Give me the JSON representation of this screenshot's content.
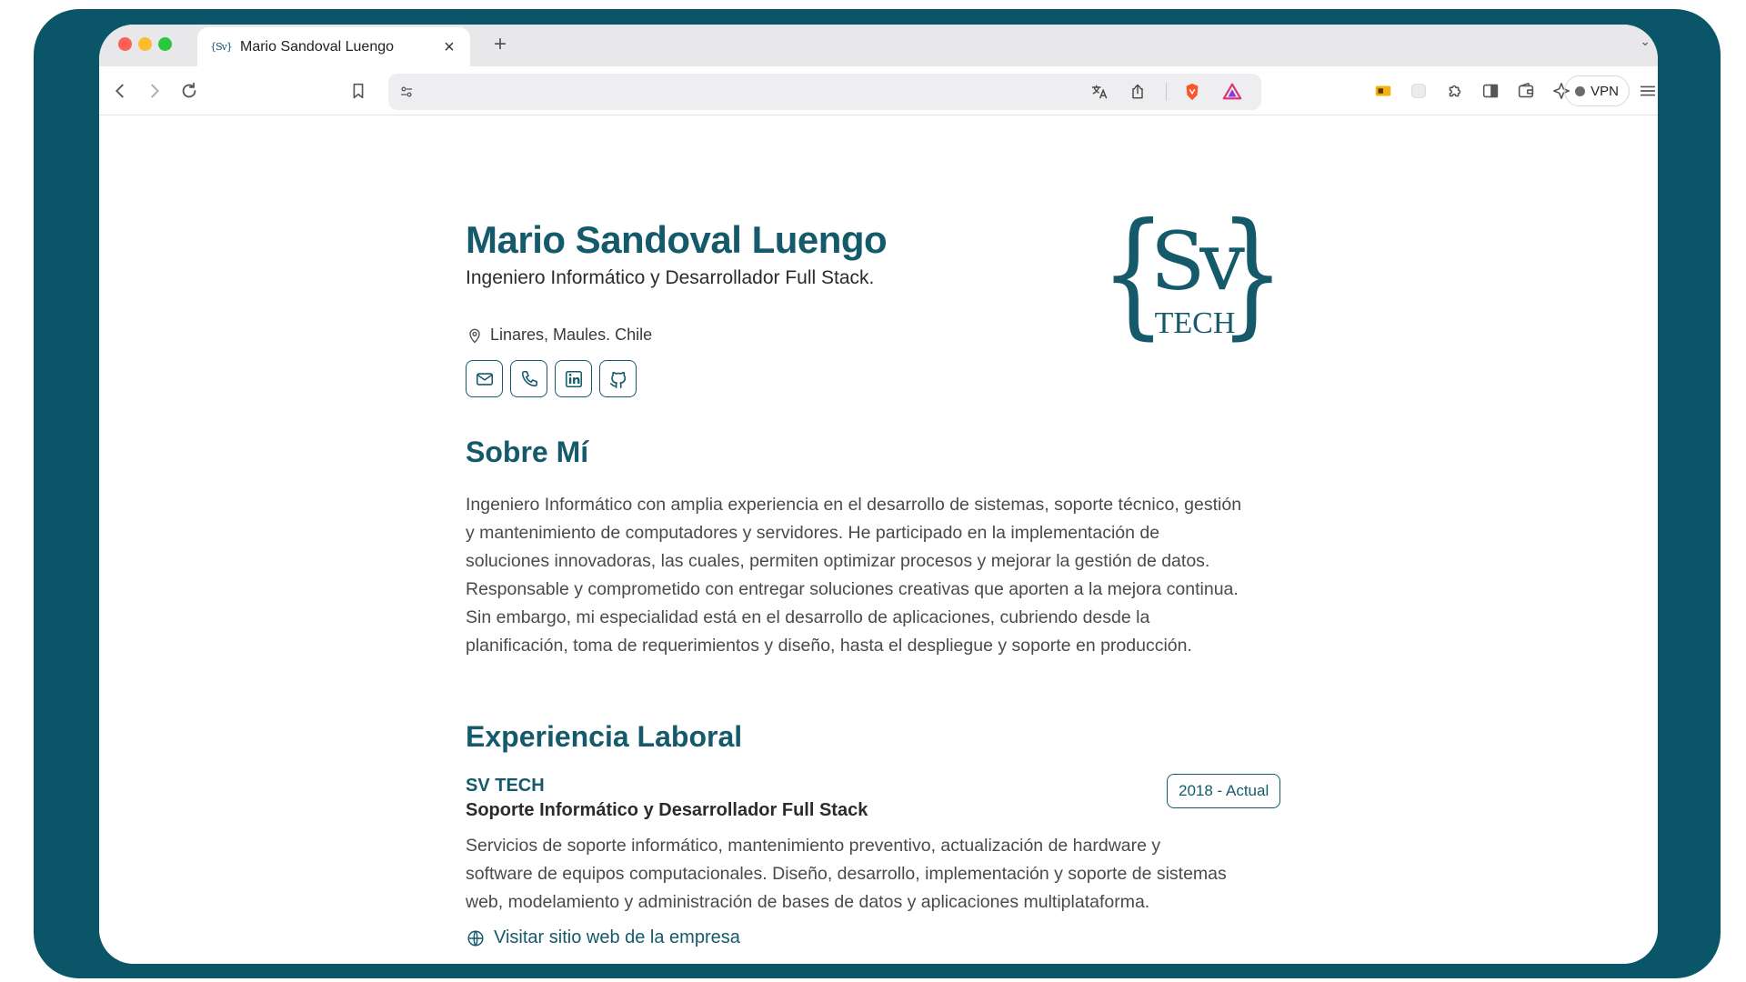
{
  "browser": {
    "tab_title": "Mario Sandoval Luengo",
    "favicon_text": "{Sv}",
    "tab_close": "×",
    "new_tab": "+",
    "url": "",
    "vpn_label": "VPN"
  },
  "profile": {
    "name": "Mario Sandoval Luengo",
    "title": "Ingeniero Informático y Desarrollador Full Stack.",
    "location": "Linares, Maules. Chile",
    "logo_text_main": "Sv",
    "logo_text_sub": "TECH"
  },
  "about": {
    "heading": "Sobre Mí",
    "lines": [
      "Ingeniero Informático con amplia experiencia en el desarrollo de sistemas, soporte técnico, gestión",
      "y mantenimiento de computadores y servidores. He participado en la implementación de",
      "soluciones innovadoras, las cuales, permiten optimizar procesos y mejorar la gestión de datos.",
      "Responsable y comprometido con entregar soluciones creativas que aporten a la mejora continua.",
      "Sin embargo, mi especialidad está en el desarrollo de aplicaciones, cubriendo desde la",
      "planificación, toma de requerimientos y diseño, hasta el despliegue y soporte en producción."
    ]
  },
  "experience": {
    "heading": "Experiencia Laboral",
    "jobs": [
      {
        "company": "SV TECH",
        "role": "Soporte Informático y Desarrollador Full Stack",
        "period": "2018 - Actual",
        "lines": [
          "Servicios de soporte informático, mantenimiento preventivo, actualización de hardware y",
          "software de equipos computacionales. Diseño, desarrollo, implementación y soporte de sistemas",
          "web, modelamiento y administración de bases de datos y aplicaciones multiplataforma."
        ],
        "link_label": "Visitar sitio web de la empresa"
      }
    ]
  },
  "colors": {
    "frame": "#0b5568",
    "accent": "#145a6b"
  }
}
